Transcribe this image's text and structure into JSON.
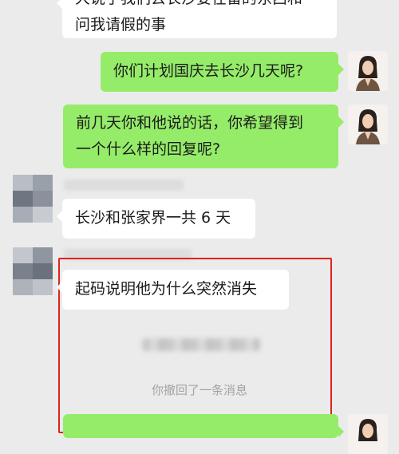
{
  "messages": [
    {
      "text_line1": "大说了我们去长沙要在留的东西和",
      "text_line2": "问我请假的事"
    },
    {
      "text": "你们计划国庆去长沙几天呢?"
    },
    {
      "text_line1": "前几天你和他说的话，你希望得到",
      "text_line2": "一个什么样的回复呢?"
    },
    {
      "text": "长沙和张家界一共 6 天"
    },
    {
      "text": "起码说明他为什么突然消失"
    }
  ],
  "system_notice": {
    "recall_text": "你撤回了一条消息"
  },
  "icons": {
    "right_avatar": "woman-portrait-avatar",
    "left_avatar": "pixelated-avatar"
  },
  "colors": {
    "background": "#ebebeb",
    "right_bubble": "#95ec69",
    "left_bubble": "#ffffff",
    "highlight_border": "#e0221c"
  }
}
